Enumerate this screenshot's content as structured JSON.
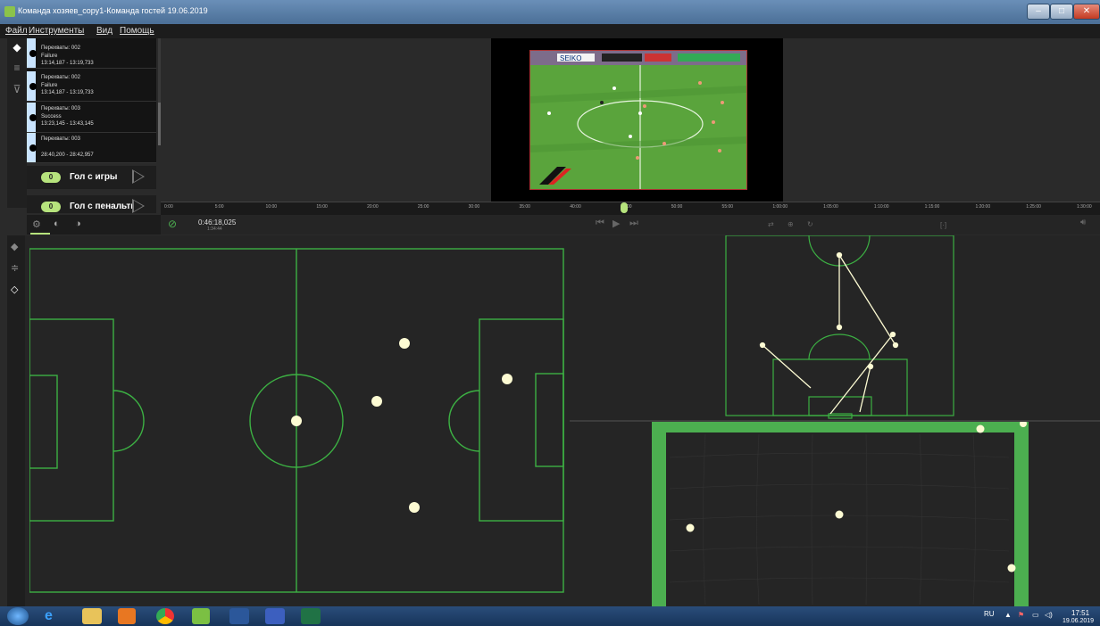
{
  "window": {
    "title": "Команда хозяев_copy1-Команда гостей 19.06.2019"
  },
  "menu": [
    "Файл",
    "Инструменты",
    "Вид",
    "Помощь"
  ],
  "events": [
    {
      "line1": "Перехваты: 002",
      "line2": "Failure",
      "line3": "13:14,187 - 13:19,733"
    },
    {
      "line1": "Перехваты: 002",
      "line2": "Failure",
      "line3": "13:14,187 - 13:19,733"
    },
    {
      "line1": "Перехваты: 003",
      "line2": "Success",
      "line3": "13:23,145 - 13:43,145"
    },
    {
      "line1": "Перехваты: 003",
      "line2": "",
      "line3": "28:40,200 - 28:42,957"
    }
  ],
  "shortcuts": [
    {
      "count": "0",
      "label": "Гол с игры"
    },
    {
      "count": "0",
      "label": "Гол с пенальти"
    }
  ],
  "timeline": {
    "ticks": [
      "0:00",
      "5:00",
      "10:00",
      "15:00",
      "20:00",
      "25:00",
      "30:00",
      "35:00",
      "40:00",
      "45:00",
      "50:00",
      "55:00",
      "1:00:00",
      "1:05:00",
      "1:10:00",
      "1:15:00",
      "1:20:00",
      "1:25:00",
      "1:30:00"
    ],
    "playhead_fraction": 0.49
  },
  "transport": {
    "timecode": "0:46:18,025",
    "duration": "1:34:44"
  },
  "video": {
    "ad_text": "SEIKO"
  },
  "taskbar": {
    "lang": "RU",
    "time": "17:51",
    "date": "19.06.2019"
  },
  "colors": {
    "accent": "#b6e37d",
    "pitch_line": "#3cb043",
    "marker": "#fdfbd3"
  }
}
